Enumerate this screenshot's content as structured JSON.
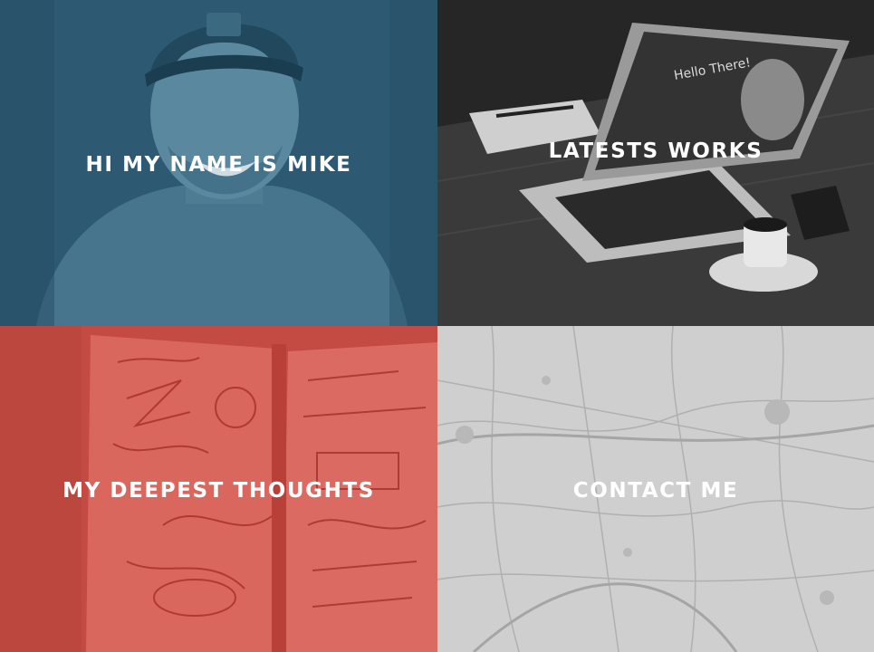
{
  "tiles": [
    {
      "label": "HI MY NAME IS MIKE",
      "color": "#2e5b73",
      "icon": "portrait-photo"
    },
    {
      "label": "LATESTS WORKS",
      "color": "#2f2f2f",
      "icon": "laptop-desk-photo"
    },
    {
      "label": "MY DEEPEST THOUGHTS",
      "color": "#c9524a",
      "icon": "notebook-sketch-photo"
    },
    {
      "label": "CONTACT ME",
      "color": "#cfcfcf",
      "icon": "map-photo"
    }
  ]
}
